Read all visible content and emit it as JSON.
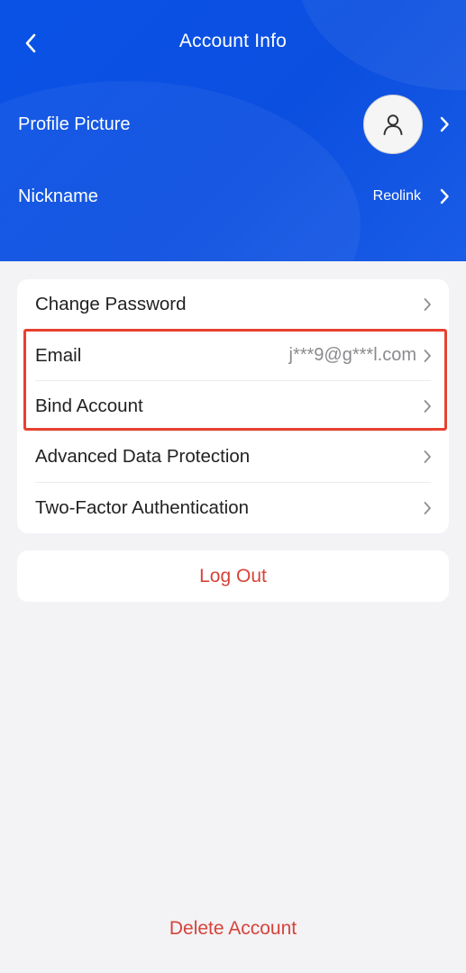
{
  "header": {
    "title": "Account Info",
    "back_icon": "chevron-left-icon",
    "profile_picture_label": "Profile Picture",
    "avatar_icon": "user-icon",
    "nickname_label": "Nickname",
    "nickname_value": "Reolink"
  },
  "settings": {
    "items": [
      {
        "label": "Change Password",
        "value": ""
      },
      {
        "label": "Email",
        "value": "j***9@g***l.com"
      },
      {
        "label": "Bind Account",
        "value": ""
      },
      {
        "label": "Advanced Data Protection",
        "value": ""
      },
      {
        "label": "Two-Factor Authentication",
        "value": ""
      }
    ]
  },
  "actions": {
    "logout_label": "Log Out",
    "delete_label": "Delete Account"
  },
  "colors": {
    "header_blue": "#0a52e6",
    "danger_red": "#d6443a",
    "highlight_red": "#e8402f",
    "background": "#f3f2f5"
  }
}
